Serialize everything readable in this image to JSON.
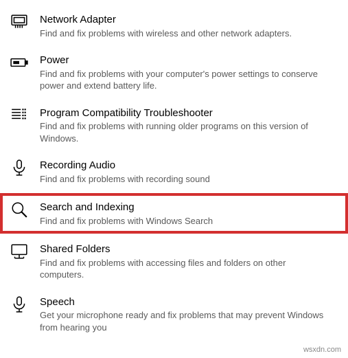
{
  "troubleshooters": [
    {
      "title": "Network Adapter",
      "desc": "Find and fix problems with wireless and other network adapters.",
      "icon": "network-adapter-icon",
      "highlighted": false
    },
    {
      "title": "Power",
      "desc": "Find and fix problems with your computer's power settings to conserve power and extend battery life.",
      "icon": "power-icon",
      "highlighted": false
    },
    {
      "title": "Program Compatibility Troubleshooter",
      "desc": "Find and fix problems with running older programs on this version of Windows.",
      "icon": "program-compatibility-icon",
      "highlighted": false
    },
    {
      "title": "Recording Audio",
      "desc": "Find and fix problems with recording sound",
      "icon": "microphone-icon",
      "highlighted": false
    },
    {
      "title": "Search and Indexing",
      "desc": "Find and fix problems with Windows Search",
      "icon": "search-icon",
      "highlighted": true
    },
    {
      "title": "Shared Folders",
      "desc": "Find and fix problems with accessing files and folders on other computers.",
      "icon": "shared-folders-icon",
      "highlighted": false
    },
    {
      "title": "Speech",
      "desc": "Get your microphone ready and fix problems that may prevent Windows from hearing you",
      "icon": "microphone-icon",
      "highlighted": false
    }
  ],
  "watermark": "wsxdn.com"
}
